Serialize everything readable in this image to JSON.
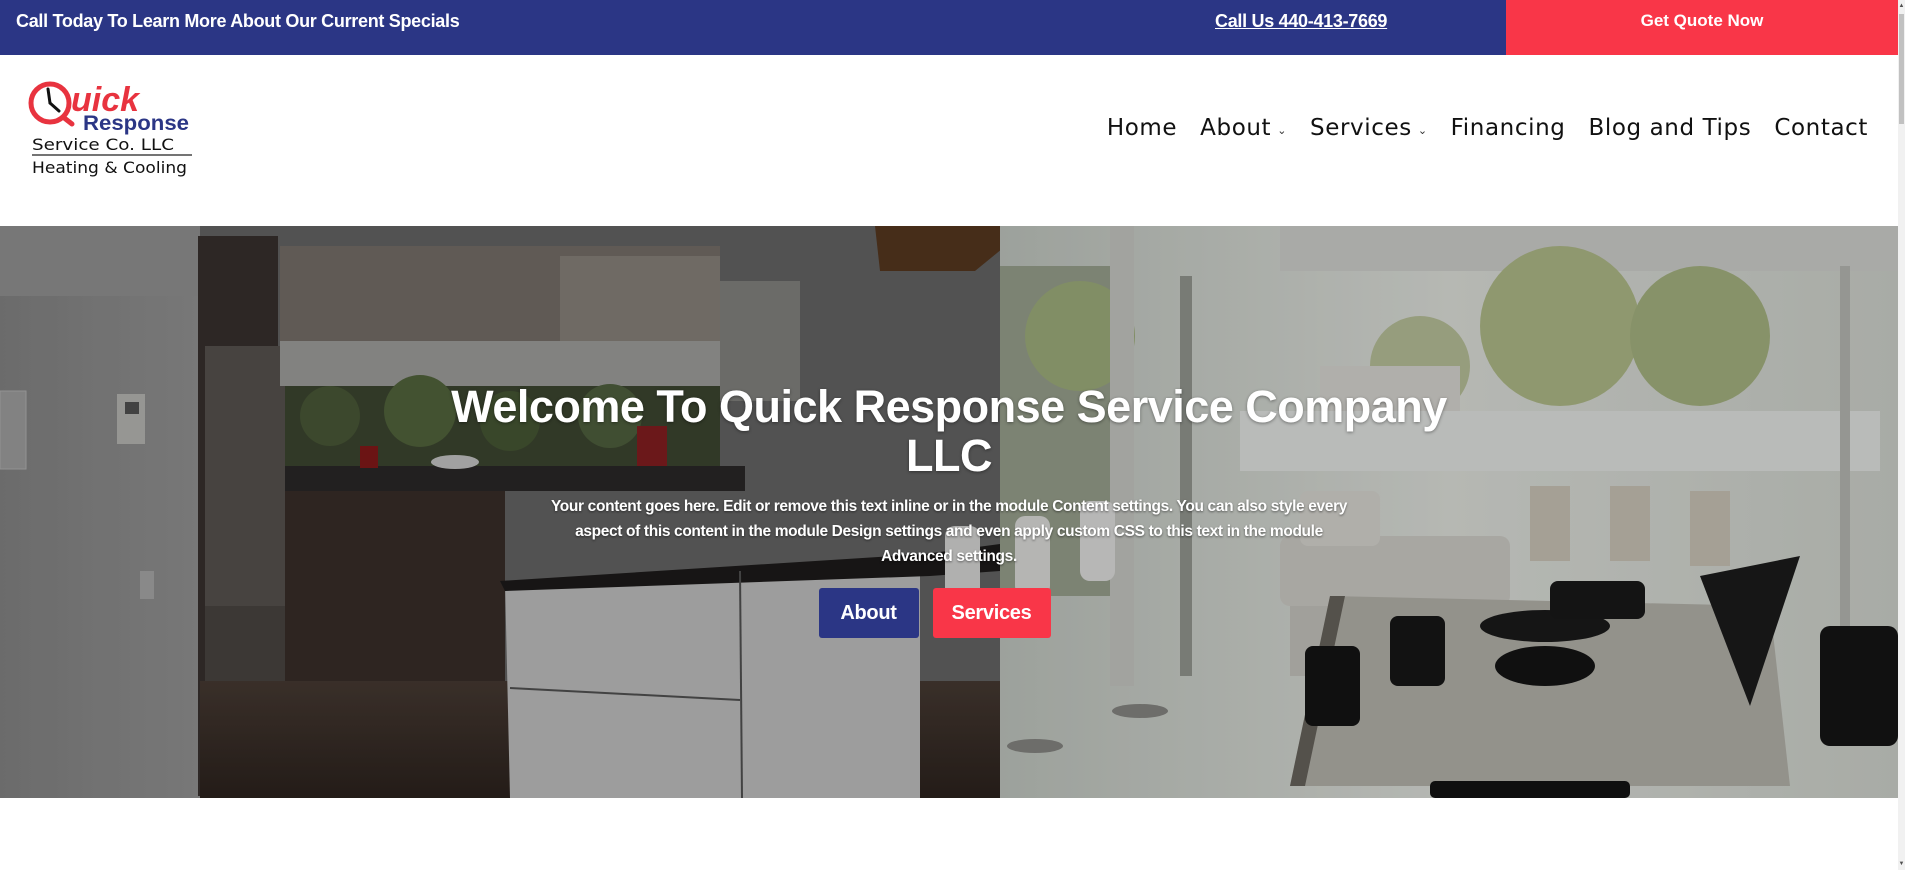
{
  "topbar": {
    "promo_text": "Call Today To Learn More About Our Current Specials",
    "phone_link": "Call Us 440-413-7669",
    "quote_button": "Get Quote Now"
  },
  "logo": {
    "line1": "uick",
    "q_letter": "Q",
    "line2": "Response",
    "line3": "Service Co. LLC",
    "line4": "Heating & Cooling"
  },
  "nav": {
    "items": [
      {
        "label": "Home",
        "has_dropdown": false
      },
      {
        "label": "About",
        "has_dropdown": true
      },
      {
        "label": "Services",
        "has_dropdown": true
      },
      {
        "label": "Financing",
        "has_dropdown": false
      },
      {
        "label": "Blog and Tips",
        "has_dropdown": false
      },
      {
        "label": "Contact",
        "has_dropdown": false
      }
    ],
    "dropdown_glyph": "⌄"
  },
  "hero": {
    "title": "Welcome To Quick Response Service Company LLC",
    "body": "Your content goes here. Edit or remove this text inline or in the module Content settings. You can also style every aspect of this content in the module Design settings and even apply custom CSS to this text in the module Advanced settings.",
    "buttons": [
      {
        "label": "About"
      },
      {
        "label": "Services"
      }
    ]
  },
  "colors": {
    "brand_blue": "#2b3685",
    "brand_red": "#f93648"
  },
  "scrollbar": {
    "up_glyph": "▲",
    "down_glyph": "▼"
  }
}
